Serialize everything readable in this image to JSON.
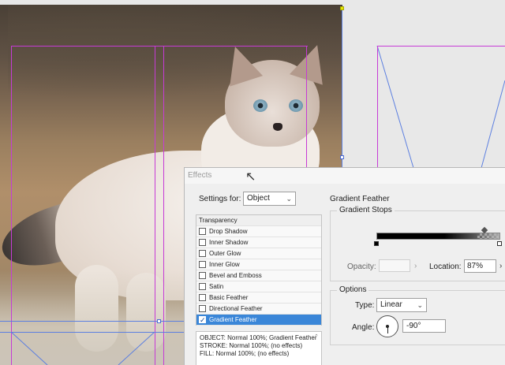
{
  "dialog": {
    "title": "Effects",
    "settings_for_label": "Settings for:",
    "settings_for_value": "Object",
    "effects_header": "Transparency",
    "effects": [
      {
        "label": "Drop Shadow",
        "checked": false
      },
      {
        "label": "Inner Shadow",
        "checked": false
      },
      {
        "label": "Outer Glow",
        "checked": false
      },
      {
        "label": "Inner Glow",
        "checked": false
      },
      {
        "label": "Bevel and Emboss",
        "checked": false
      },
      {
        "label": "Satin",
        "checked": false
      },
      {
        "label": "Basic Feather",
        "checked": false
      },
      {
        "label": "Directional Feather",
        "checked": false
      },
      {
        "label": "Gradient Feather",
        "checked": true,
        "selected": true
      }
    ],
    "summary": [
      "OBJECT: Normal 100%; Gradient Feather",
      "STROKE: Normal 100%; (no effects)",
      "FILL: Normal 100%; (no effects)"
    ],
    "section_title": "Gradient Feather",
    "gradient_stops_label": "Gradient Stops",
    "opacity_label": "Opacity:",
    "opacity_value": "",
    "location_label": "Location:",
    "location_value": "87%",
    "options_label": "Options",
    "type_label": "Type:",
    "type_value": "Linear",
    "angle_label": "Angle:",
    "angle_value": "-90°"
  },
  "icons": {
    "chevron": "⌵",
    "arrow_right": "›"
  },
  "colors": {
    "selection": "#3a86d8",
    "margin_guide": "#c63bd6",
    "frame_line": "#5c7fe0"
  }
}
